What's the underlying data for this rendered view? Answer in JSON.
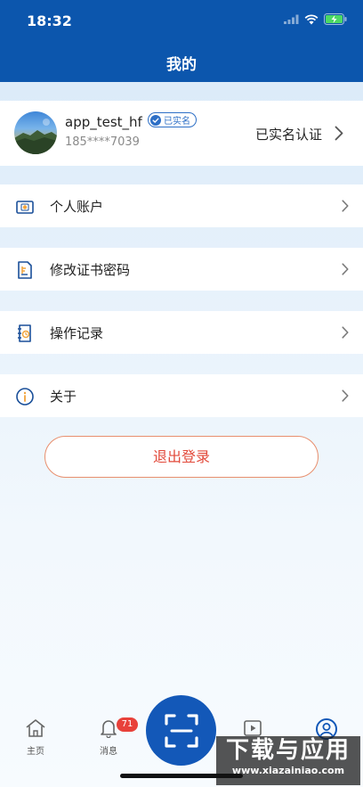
{
  "status_bar": {
    "time": "18:32"
  },
  "header": {
    "title": "我的"
  },
  "profile": {
    "username": "app_test_hf",
    "badge": "已实名",
    "phone": "185****7039",
    "status": "已实名认证"
  },
  "menu": [
    {
      "label": "个人账户",
      "icon": "wallet-icon"
    },
    {
      "label": "修改证书密码",
      "icon": "certificate-icon"
    },
    {
      "label": "操作记录",
      "icon": "record-icon"
    },
    {
      "label": "关于",
      "icon": "info-icon"
    }
  ],
  "logout_label": "退出登录",
  "tabbar": {
    "home": "主页",
    "messages": "消息",
    "messages_badge": "71"
  },
  "watermark": {
    "title": "下载与应用",
    "sub": "www.xiazainiao.com"
  },
  "colors": {
    "brand": "#0c56ad",
    "logout": "#e2493a",
    "badge": "#e8413a"
  }
}
